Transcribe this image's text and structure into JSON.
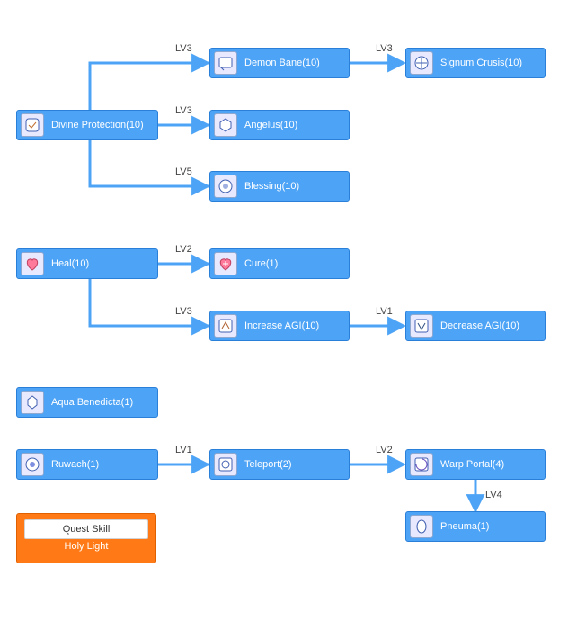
{
  "skills": {
    "divine_protection": {
      "name": "Divine Protection",
      "level": 10
    },
    "demon_bane": {
      "name": "Demon Bane",
      "level": 10
    },
    "signum_crucis": {
      "name": "Signum Crusis",
      "level": 10
    },
    "angelus": {
      "name": "Angelus",
      "level": 10
    },
    "blessing": {
      "name": "Blessing",
      "level": 10
    },
    "heal": {
      "name": "Heal",
      "level": 10
    },
    "cure": {
      "name": "Cure",
      "level": 1
    },
    "increase_agi": {
      "name": "Increase AGI",
      "level": 10
    },
    "decrease_agi": {
      "name": "Decrease AGI",
      "level": 10
    },
    "aqua_benedicta": {
      "name": "Aqua Benedicta",
      "level": 1
    },
    "ruwach": {
      "name": "Ruwach",
      "level": 1
    },
    "teleport": {
      "name": "Teleport",
      "level": 2
    },
    "warp_portal": {
      "name": "Warp Portal",
      "level": 4
    },
    "pneuma": {
      "name": "Pneuma",
      "level": 1
    }
  },
  "edges": {
    "dp_demon": {
      "req": "LV3"
    },
    "demon_sign": {
      "req": "LV3"
    },
    "dp_angelus": {
      "req": "LV3"
    },
    "dp_blessing": {
      "req": "LV5"
    },
    "heal_cure": {
      "req": "LV2"
    },
    "heal_incagi": {
      "req": "LV3"
    },
    "inc_dec": {
      "req": "LV1"
    },
    "ruwach_tele": {
      "req": "LV1"
    },
    "tele_warp": {
      "req": "LV2"
    },
    "warp_pneuma": {
      "req": "LV4"
    }
  },
  "quest": {
    "header": "Quest Skill",
    "label": "Holy Light"
  }
}
